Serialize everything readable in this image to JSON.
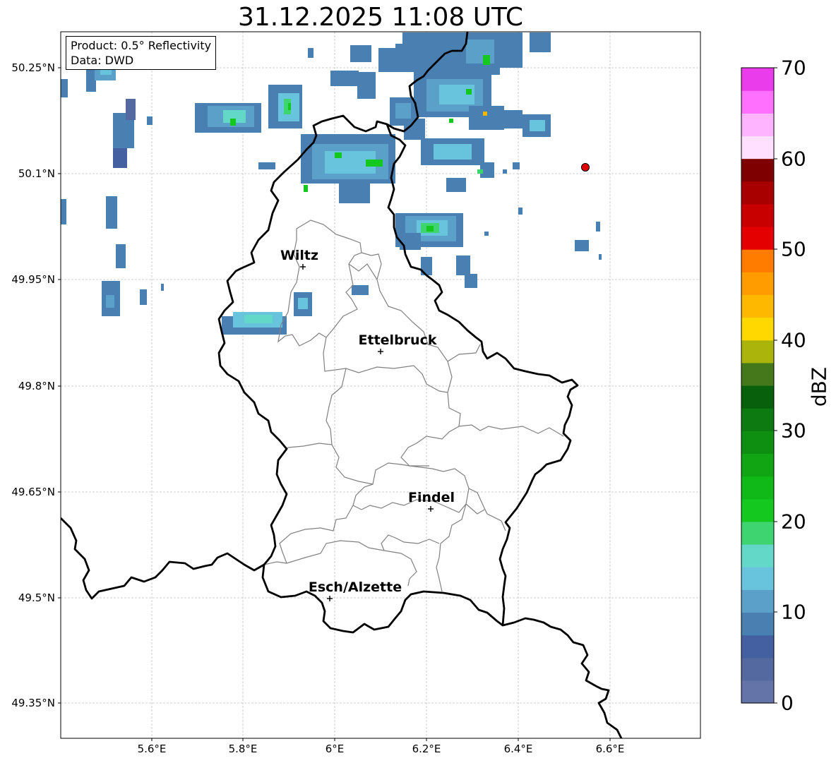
{
  "title": "31.12.2025 11:08 UTC",
  "info": {
    "product": "Product: 0.5° Reflectivity",
    "source": "Data: DWD"
  },
  "axes": {
    "lat_labels": [
      "50.25°N",
      "50.1°N",
      "49.95°N",
      "49.8°N",
      "49.65°N",
      "49.5°N",
      "49.35°N"
    ],
    "lon_labels": [
      "5.6°E",
      "5.8°E",
      "6°E",
      "6.2°E",
      "6.4°E",
      "6.6°E"
    ]
  },
  "cities": [
    {
      "name": "Wiltz"
    },
    {
      "name": "Ettelbruck"
    },
    {
      "name": "Findel"
    },
    {
      "name": "Esch/Alzette"
    }
  ],
  "colorbar": {
    "label": "dBZ",
    "ticks": [
      "70",
      "60",
      "50",
      "40",
      "30",
      "20",
      "10",
      "0"
    ],
    "range": [
      0,
      70
    ],
    "step": 2.5,
    "colors": [
      "#6474a8",
      "#53699f",
      "#4460a0",
      "#4a7fb2",
      "#5aa0c8",
      "#68c4dc",
      "#64d8c8",
      "#3ed470",
      "#14c820",
      "#10b818",
      "#11a514",
      "#0f8f12",
      "#0c7a10",
      "#08600c",
      "#44781a",
      "#aab40a",
      "#ffd800",
      "#ffb800",
      "#ff9c00",
      "#ff7c00",
      "#e40000",
      "#c80000",
      "#a80000",
      "#7e0000",
      "#ffe0ff",
      "#ffb4ff",
      "#ff70ff",
      "#ea3cea"
    ]
  },
  "colors": {
    "border": "#000000",
    "district": "#808080",
    "grid": "#c0c0c0",
    "radar_site": "#e10000"
  }
}
